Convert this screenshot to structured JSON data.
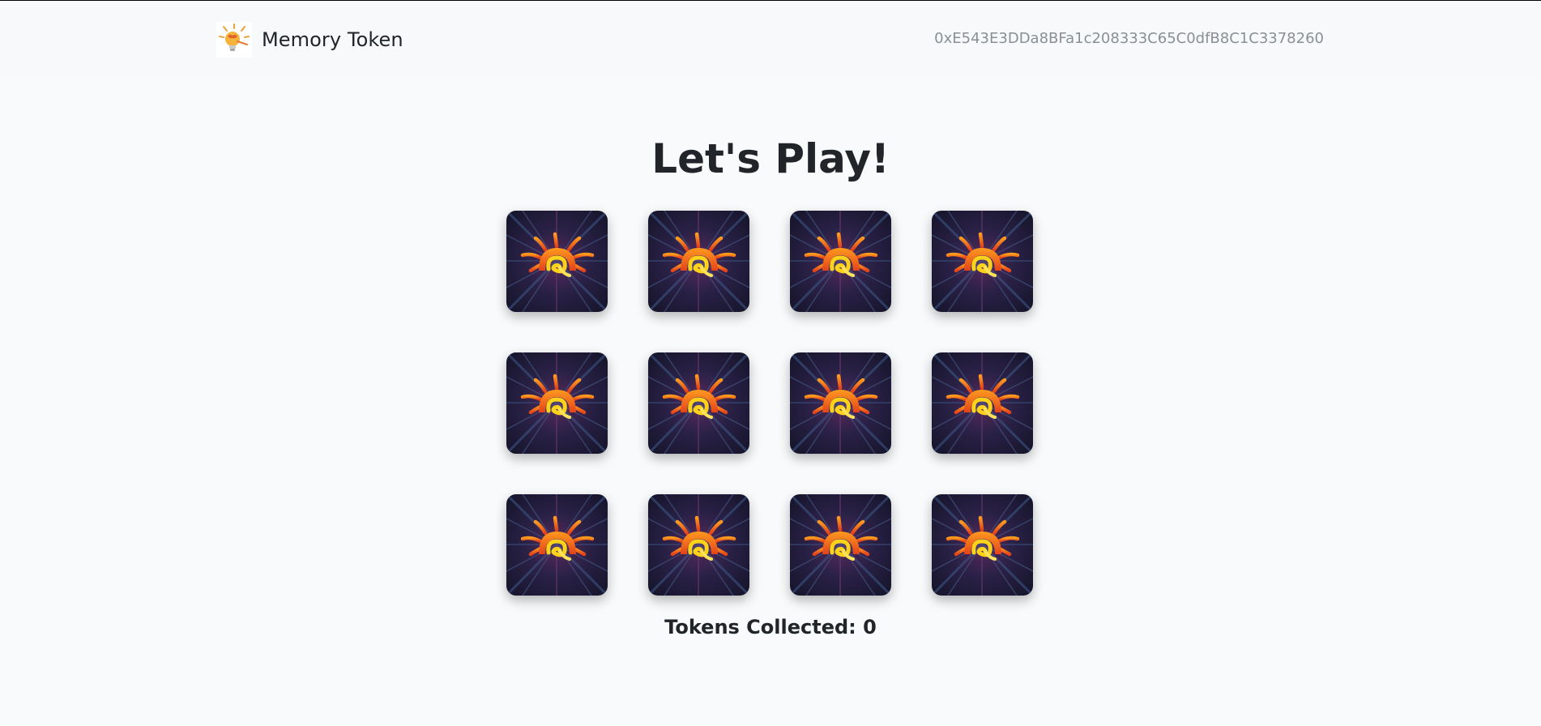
{
  "navbar": {
    "brand_name": "Memory Token",
    "logo_icon": "lightbulb-brain-icon",
    "account_address": "0xE543E3DDa8BFa1c208333C65C0dfB8C1C3378260"
  },
  "game": {
    "title": "Let's Play!",
    "card_back_icon": "blockchain-sunburst-icon",
    "cards": [
      {
        "state": "face-down"
      },
      {
        "state": "face-down"
      },
      {
        "state": "face-down"
      },
      {
        "state": "face-down"
      },
      {
        "state": "face-down"
      },
      {
        "state": "face-down"
      },
      {
        "state": "face-down"
      },
      {
        "state": "face-down"
      },
      {
        "state": "face-down"
      },
      {
        "state": "face-down"
      },
      {
        "state": "face-down"
      },
      {
        "state": "face-down"
      }
    ],
    "tokens_label": "Tokens Collected: ",
    "tokens_collected": "0"
  },
  "colors": {
    "background": "#f9fafb",
    "navbar": "#f8f9fa",
    "card_bg": "#1b1830",
    "accent_orange": "#f26b1d",
    "accent_yellow": "#ffd21a"
  }
}
